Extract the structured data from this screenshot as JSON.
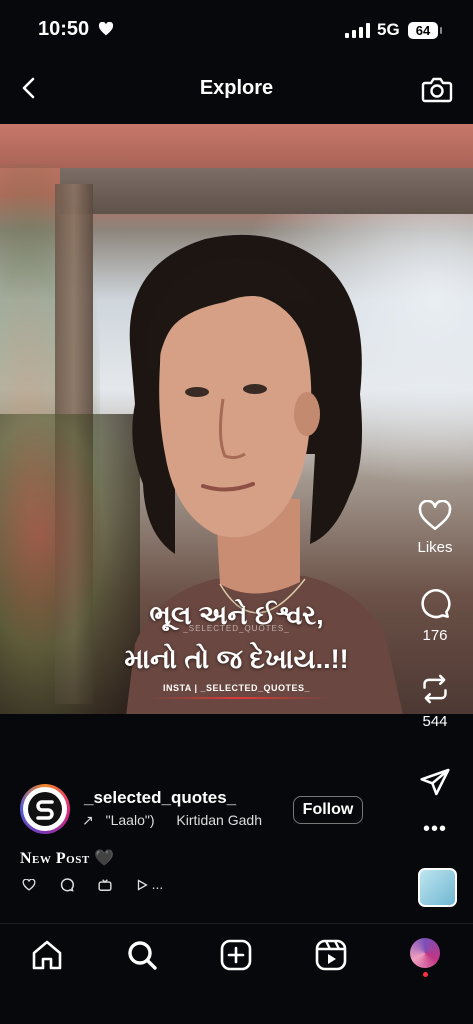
{
  "status_bar": {
    "time": "10:50",
    "network": "5G",
    "battery": "64"
  },
  "header": {
    "title": "Explore"
  },
  "post": {
    "quote_line1": "ભૂલ અને ઈશ્વર,",
    "quote_line2": "માનો તો જ દેખાય..!!",
    "watermark": "_SELECTED_QUOTES_",
    "insta_tag": "INSTA | _SELECTED_QUOTES_"
  },
  "actions": {
    "likes_label": "Likes",
    "comments_count": "176",
    "reposts_count": "544"
  },
  "author": {
    "username": "_selected_quotes_",
    "audio_track": "\"Laalo\")",
    "audio_artist": "Kirtidan Gadh",
    "follow_label": "Follow"
  },
  "caption": {
    "text": "New Post 🖤",
    "more": "..."
  },
  "colors": {
    "background": "#06080c",
    "notification_dot": "#ff3040",
    "accent_red": "#e03a3a"
  }
}
